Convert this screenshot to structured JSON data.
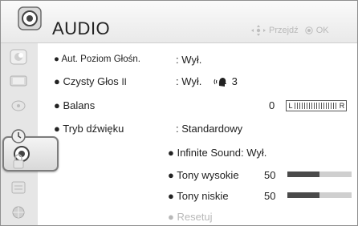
{
  "header": {
    "title": "AUDIO",
    "hint_move": "Przejdź",
    "hint_ok": "OK",
    "header_icon": "audio-icon"
  },
  "sidebar": {
    "items": [
      {
        "icon": "picture-icon"
      },
      {
        "icon": "display-icon"
      },
      {
        "icon": "audio-icon",
        "selected": true
      },
      {
        "icon": "time-icon"
      },
      {
        "icon": "lock-icon"
      },
      {
        "icon": "options-icon"
      },
      {
        "icon": "network-icon"
      }
    ]
  },
  "settings": {
    "auto_volume": {
      "label": "Aut. Poziom Głośn.",
      "value": ": Wył."
    },
    "clear_voice": {
      "label": "Czysty Głos",
      "suffix": "II",
      "value": ": Wył.",
      "level": "3"
    },
    "balance": {
      "label": "Balans",
      "value": "0",
      "left_label": "L",
      "right_label": "R",
      "position_fraction": 0.5
    },
    "sound_mode": {
      "label": "Tryb dźwięku",
      "value": ": Standardowy"
    },
    "infinite_sound": {
      "label": "Infinite Sound",
      "value": "Wył."
    },
    "treble": {
      "label": "Tony wysokie",
      "value": "50",
      "fraction": 0.5
    },
    "bass": {
      "label": "Tony niskie",
      "value": "50",
      "fraction": 0.5
    },
    "reset": {
      "label": "Resetuj"
    }
  },
  "colors": {
    "bar_fill": "#4a4a4a",
    "bar_track": "#cfcfcf",
    "selection_border": "#7d7d7d"
  }
}
